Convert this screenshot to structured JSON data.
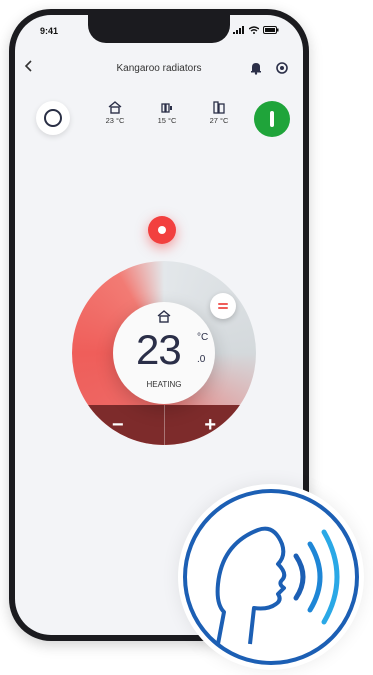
{
  "status_bar": {
    "time": "9:41"
  },
  "header": {
    "title": "Kangaroo radiators"
  },
  "zones": [
    {
      "icon": "house-icon",
      "temp": "23 °C"
    },
    {
      "icon": "radiator-icon",
      "temp": "15 °C"
    },
    {
      "icon": "building-icon",
      "temp": "27 °C"
    }
  ],
  "thermostat": {
    "temperature": "23",
    "unit": "°C",
    "decimal": ".0",
    "mode": "HEATING",
    "minus_label": "−",
    "plus_label": "+"
  },
  "colors": {
    "accent": "#f2403f",
    "dial_dark": "#7d2b2b",
    "power_on": "#1fa43a",
    "voice_blue": "#1c5fb4"
  }
}
